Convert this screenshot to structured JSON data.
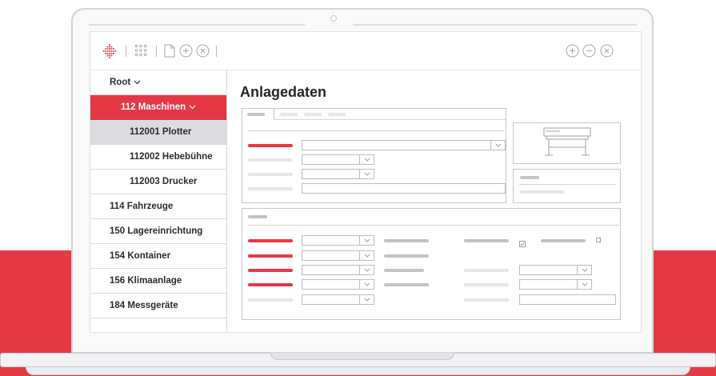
{
  "colors": {
    "accent": "#e53845",
    "placeholder_bar": "#c3c3c8",
    "border": "#c9c9ce"
  },
  "toolbar": {
    "left_icons": [
      "logo-diamond-icon",
      "grid-icon",
      "document-icon",
      "add-circle-icon",
      "close-circle-icon"
    ],
    "right_icons": [
      "add-circle-icon",
      "remove-circle-icon",
      "close-circle-icon"
    ]
  },
  "sidebar": {
    "items": [
      {
        "label": "Root",
        "chevron": "chevron-down-icon"
      },
      {
        "label": "112 Maschinen",
        "chevron": "chevron-down-icon",
        "state": "active"
      },
      {
        "label": "112001 Plotter",
        "state": "selected"
      },
      {
        "label": "112002 Hebebühne"
      },
      {
        "label": "112003 Drucker"
      },
      {
        "label": "114 Fahrzeuge"
      },
      {
        "label": "150 Lagereinrichtung"
      },
      {
        "label": "154 Kontainer"
      },
      {
        "label": "156 Klimaanlage"
      },
      {
        "label": "184 Messgeräte"
      }
    ]
  },
  "main": {
    "title": "Anlagedaten",
    "preview_icon": "plotter-icon"
  }
}
